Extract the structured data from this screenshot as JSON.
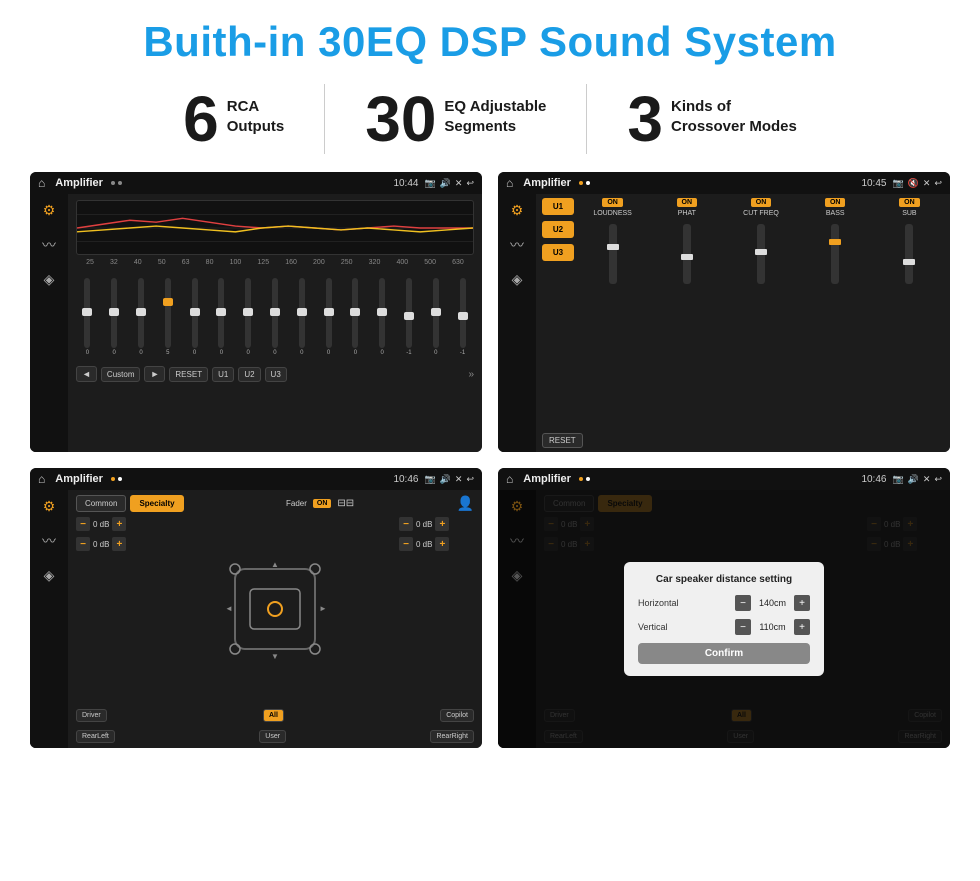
{
  "header": {
    "title": "Buith-in 30EQ DSP Sound System"
  },
  "stats": [
    {
      "number": "6",
      "label_line1": "RCA",
      "label_line2": "Outputs"
    },
    {
      "number": "30",
      "label_line1": "EQ Adjustable",
      "label_line2": "Segments"
    },
    {
      "number": "3",
      "label_line1": "Kinds of",
      "label_line2": "Crossover Modes"
    }
  ],
  "screens": {
    "top_left": {
      "status": {
        "title": "Amplifier",
        "time": "10:44"
      },
      "freqs": [
        "25",
        "32",
        "40",
        "50",
        "63",
        "80",
        "100",
        "125",
        "160",
        "200",
        "250",
        "320",
        "400",
        "500",
        "630"
      ],
      "vals": [
        "0",
        "0",
        "0",
        "5",
        "0",
        "0",
        "0",
        "0",
        "0",
        "0",
        "0",
        "0",
        "-1",
        "0",
        "-1"
      ],
      "preset": "Custom",
      "buttons": [
        "RESET",
        "U1",
        "U2",
        "U3"
      ]
    },
    "top_right": {
      "status": {
        "title": "Amplifier",
        "time": "10:45"
      },
      "presets": [
        "U1",
        "U2",
        "U3"
      ],
      "channels": [
        {
          "on": true,
          "label": "LOUDNESS"
        },
        {
          "on": true,
          "label": "PHAT"
        },
        {
          "on": true,
          "label": "CUT FREQ"
        },
        {
          "on": true,
          "label": "BASS"
        },
        {
          "on": true,
          "label": "SUB"
        }
      ],
      "reset_label": "RESET"
    },
    "bottom_left": {
      "status": {
        "title": "Amplifier",
        "time": "10:46"
      },
      "tabs": [
        "Common",
        "Specialty"
      ],
      "fader_label": "Fader",
      "db_controls": [
        "0 dB",
        "0 dB",
        "0 dB",
        "0 dB"
      ],
      "buttons": [
        "Driver",
        "Copilot",
        "RearLeft",
        "All",
        "User",
        "RearRight"
      ]
    },
    "bottom_right": {
      "status": {
        "title": "Amplifier",
        "time": "10:46"
      },
      "tabs": [
        "Common",
        "Specialty"
      ],
      "dialog": {
        "title": "Car speaker distance setting",
        "fields": [
          {
            "label": "Horizontal",
            "value": "140cm"
          },
          {
            "label": "Vertical",
            "value": "110cm"
          }
        ],
        "confirm_label": "Confirm"
      },
      "buttons": [
        "Driver",
        "Copilot",
        "RearLeft",
        "All",
        "User",
        "RearRight"
      ]
    }
  }
}
